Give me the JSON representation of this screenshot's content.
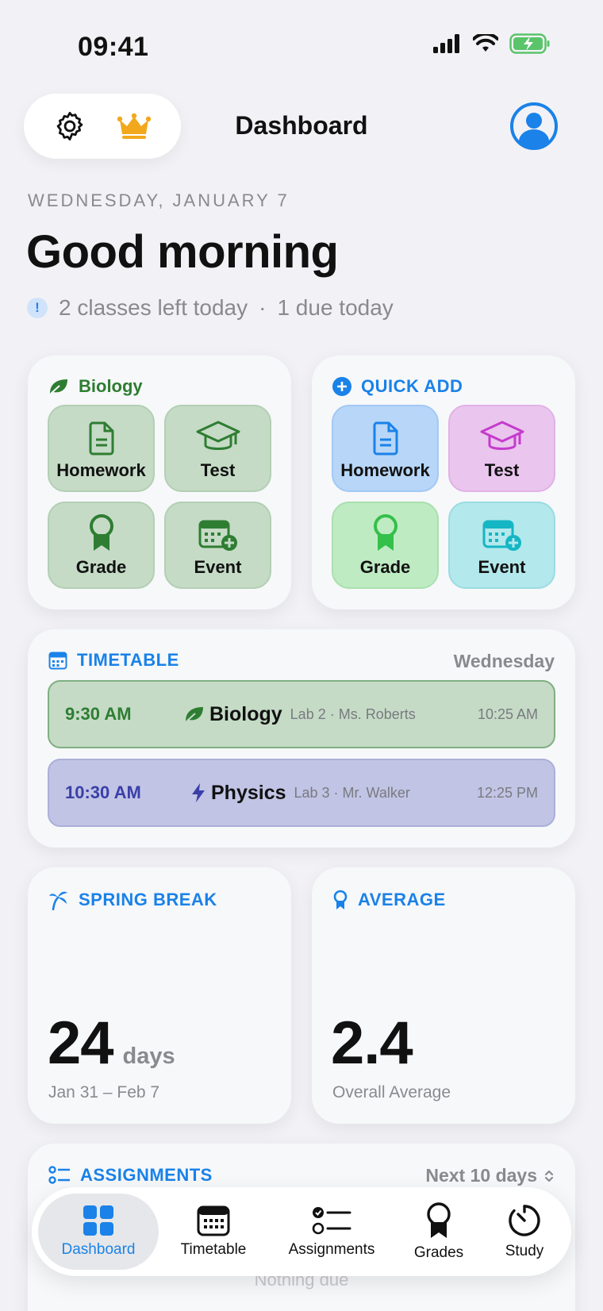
{
  "status_bar": {
    "time": "09:41"
  },
  "header": {
    "title": "Dashboard"
  },
  "date_line": "WEDNESDAY, JANUARY 7",
  "greeting": "Good morning",
  "summary": {
    "classes_left": "2 classes left today",
    "separator": "·",
    "due": "1 due today",
    "info_icon": "!"
  },
  "current_class_card": {
    "subject": "Biology",
    "tiles": [
      {
        "label": "Homework",
        "icon": "document-icon"
      },
      {
        "label": "Test",
        "icon": "graduation-cap-icon"
      },
      {
        "label": "Grade",
        "icon": "award-ribbon-icon"
      },
      {
        "label": "Event",
        "icon": "calendar-plus-icon"
      }
    ]
  },
  "quick_add_card": {
    "title": "QUICK ADD",
    "tiles": [
      {
        "label": "Homework",
        "icon": "document-icon"
      },
      {
        "label": "Test",
        "icon": "graduation-cap-icon"
      },
      {
        "label": "Grade",
        "icon": "award-ribbon-icon"
      },
      {
        "label": "Event",
        "icon": "calendar-plus-icon"
      }
    ]
  },
  "timetable": {
    "title": "TIMETABLE",
    "day": "Wednesday",
    "rows": [
      {
        "start": "9:30 AM",
        "subject": "Biology",
        "detail": "Lab 2 · Ms. Roberts",
        "end": "10:25 AM",
        "color": "#C5DBC6"
      },
      {
        "start": "10:30 AM",
        "subject": "Physics",
        "detail": "Lab 3 · Mr. Walker",
        "end": "12:25 PM",
        "color": "#C1C4E4"
      }
    ]
  },
  "spring_break": {
    "title": "SPRING BREAK",
    "count": "24",
    "unit": "days",
    "range": "Jan 31 – Feb 7"
  },
  "average": {
    "title": "AVERAGE",
    "value": "2.4",
    "caption": "Overall Average"
  },
  "assignments": {
    "title": "ASSIGNMENTS",
    "filter": "Next 10 days",
    "empty": "Nothing due"
  },
  "tabs": [
    {
      "label": "Dashboard",
      "active": true
    },
    {
      "label": "Timetable"
    },
    {
      "label": "Assignments"
    },
    {
      "label": "Grades"
    },
    {
      "label": "Study"
    }
  ],
  "colors": {
    "accent": "#1A82E8",
    "green": "#2E7D32",
    "purple": "#3A3FA8",
    "crown": "#F2A81D"
  }
}
